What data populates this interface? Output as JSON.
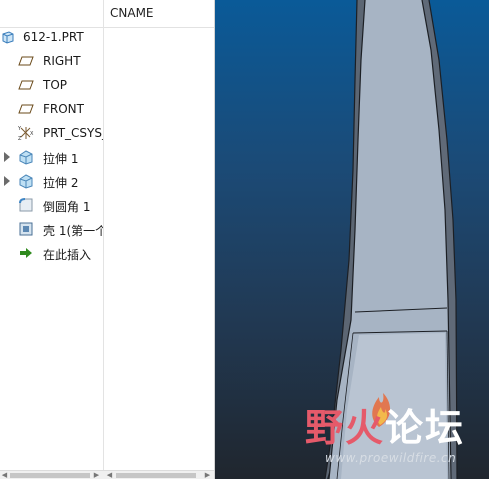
{
  "model_tree": {
    "column_header": "CNAME",
    "items": [
      {
        "label": "612-1.PRT",
        "icon": "part-icon",
        "expandable": false
      },
      {
        "label": "RIGHT",
        "icon": "datum-plane-icon",
        "expandable": false
      },
      {
        "label": "TOP",
        "icon": "datum-plane-icon",
        "expandable": false
      },
      {
        "label": "FRONT",
        "icon": "datum-plane-icon",
        "expandable": false
      },
      {
        "label": "PRT_CSYS_",
        "icon": "coordinate-system-icon",
        "expandable": false
      },
      {
        "label": "拉伸 1",
        "icon": "extrude-icon",
        "expandable": true
      },
      {
        "label": "拉伸 2",
        "icon": "extrude-icon",
        "expandable": true
      },
      {
        "label": "倒圆角 1",
        "icon": "round-icon",
        "expandable": false
      },
      {
        "label": "壳 1(第一个",
        "icon": "shell-icon",
        "expandable": false
      },
      {
        "label": "在此插入",
        "icon": "insert-here-arrow-icon",
        "expandable": false
      }
    ]
  },
  "watermark": {
    "text_part1": "野火",
    "text_part2": "论坛",
    "url": "www.proewildfire.cn"
  },
  "colors": {
    "viewport_top": "#0a5a98",
    "viewport_bottom": "#20262e",
    "model_fill": "#a9b6c6",
    "watermark_accent": "#e55a6a"
  }
}
